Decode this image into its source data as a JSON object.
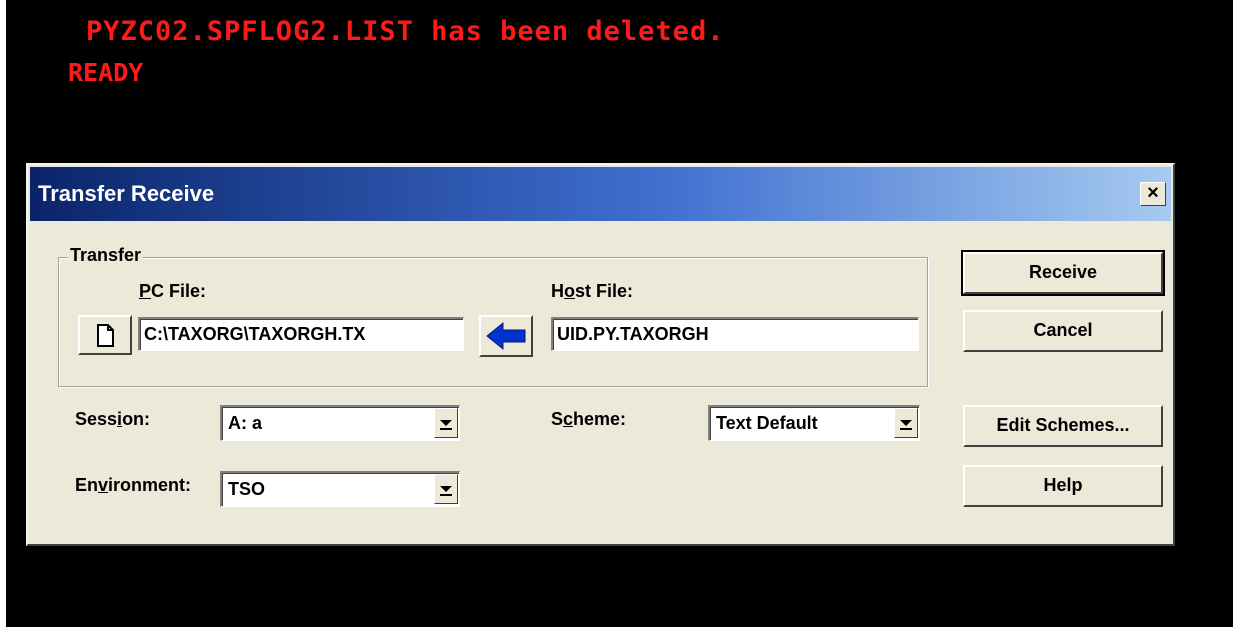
{
  "terminal": {
    "line1": "PYZC02.SPFLOG2.LIST has been deleted.",
    "line2": "READY",
    "text_color": "#ff1a1a"
  },
  "dialog": {
    "title": "Transfer Receive",
    "close_label": "×",
    "transfer_group": {
      "legend": "Transfer",
      "pc_file_label": {
        "mnemonic": "P",
        "rest": "C File:"
      },
      "pc_file_value": "C:\\TAXORG\\TAXORGH.TX",
      "host_file_label": {
        "pre": "H",
        "mnemonic": "o",
        "rest": "st File:"
      },
      "host_file_value": "UID.PY.TAXORGH"
    },
    "session": {
      "label": {
        "pre": "Sess",
        "mnemonic": "i",
        "rest": "on:"
      },
      "value": "A: a"
    },
    "environment": {
      "label": {
        "pre": "En",
        "mnemonic": "v",
        "rest": "ironment:"
      },
      "value": "TSO"
    },
    "scheme": {
      "label": {
        "pre": "S",
        "mnemonic": "c",
        "rest": "heme:"
      },
      "value": "Text Default"
    },
    "buttons": {
      "receive": "Receive",
      "cancel": "Cancel",
      "edit_schemes": "Edit Schemes...",
      "help": "Help"
    }
  },
  "icons": {
    "browse": "document-icon",
    "direction": "left-arrow-icon",
    "direction_color": "#0033cc"
  }
}
